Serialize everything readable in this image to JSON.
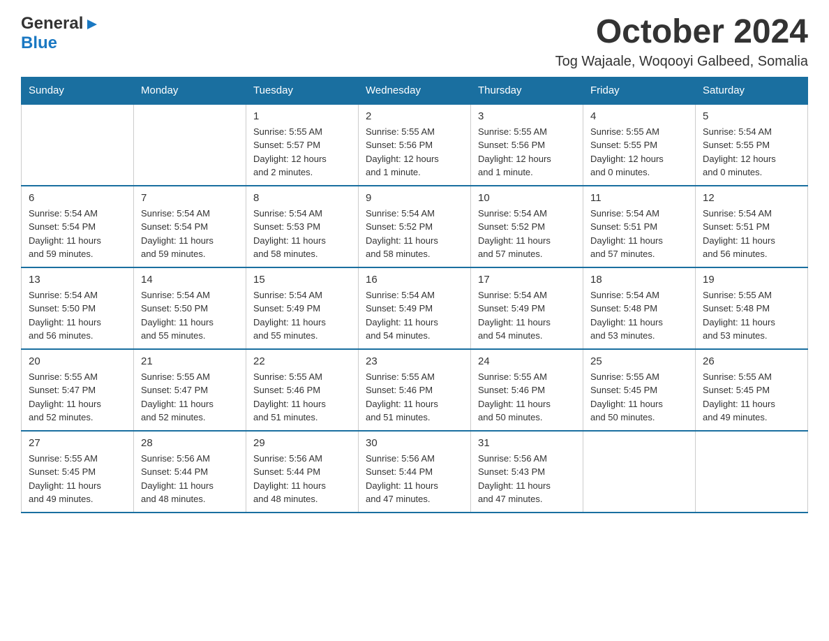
{
  "logo": {
    "general": "General",
    "blue": "Blue"
  },
  "title": "October 2024",
  "location": "Tog Wajaale, Woqooyi Galbeed, Somalia",
  "days": [
    "Sunday",
    "Monday",
    "Tuesday",
    "Wednesday",
    "Thursday",
    "Friday",
    "Saturday"
  ],
  "weeks": [
    [
      {
        "num": "",
        "info": ""
      },
      {
        "num": "",
        "info": ""
      },
      {
        "num": "1",
        "info": "Sunrise: 5:55 AM\nSunset: 5:57 PM\nDaylight: 12 hours\nand 2 minutes."
      },
      {
        "num": "2",
        "info": "Sunrise: 5:55 AM\nSunset: 5:56 PM\nDaylight: 12 hours\nand 1 minute."
      },
      {
        "num": "3",
        "info": "Sunrise: 5:55 AM\nSunset: 5:56 PM\nDaylight: 12 hours\nand 1 minute."
      },
      {
        "num": "4",
        "info": "Sunrise: 5:55 AM\nSunset: 5:55 PM\nDaylight: 12 hours\nand 0 minutes."
      },
      {
        "num": "5",
        "info": "Sunrise: 5:54 AM\nSunset: 5:55 PM\nDaylight: 12 hours\nand 0 minutes."
      }
    ],
    [
      {
        "num": "6",
        "info": "Sunrise: 5:54 AM\nSunset: 5:54 PM\nDaylight: 11 hours\nand 59 minutes."
      },
      {
        "num": "7",
        "info": "Sunrise: 5:54 AM\nSunset: 5:54 PM\nDaylight: 11 hours\nand 59 minutes."
      },
      {
        "num": "8",
        "info": "Sunrise: 5:54 AM\nSunset: 5:53 PM\nDaylight: 11 hours\nand 58 minutes."
      },
      {
        "num": "9",
        "info": "Sunrise: 5:54 AM\nSunset: 5:52 PM\nDaylight: 11 hours\nand 58 minutes."
      },
      {
        "num": "10",
        "info": "Sunrise: 5:54 AM\nSunset: 5:52 PM\nDaylight: 11 hours\nand 57 minutes."
      },
      {
        "num": "11",
        "info": "Sunrise: 5:54 AM\nSunset: 5:51 PM\nDaylight: 11 hours\nand 57 minutes."
      },
      {
        "num": "12",
        "info": "Sunrise: 5:54 AM\nSunset: 5:51 PM\nDaylight: 11 hours\nand 56 minutes."
      }
    ],
    [
      {
        "num": "13",
        "info": "Sunrise: 5:54 AM\nSunset: 5:50 PM\nDaylight: 11 hours\nand 56 minutes."
      },
      {
        "num": "14",
        "info": "Sunrise: 5:54 AM\nSunset: 5:50 PM\nDaylight: 11 hours\nand 55 minutes."
      },
      {
        "num": "15",
        "info": "Sunrise: 5:54 AM\nSunset: 5:49 PM\nDaylight: 11 hours\nand 55 minutes."
      },
      {
        "num": "16",
        "info": "Sunrise: 5:54 AM\nSunset: 5:49 PM\nDaylight: 11 hours\nand 54 minutes."
      },
      {
        "num": "17",
        "info": "Sunrise: 5:54 AM\nSunset: 5:49 PM\nDaylight: 11 hours\nand 54 minutes."
      },
      {
        "num": "18",
        "info": "Sunrise: 5:54 AM\nSunset: 5:48 PM\nDaylight: 11 hours\nand 53 minutes."
      },
      {
        "num": "19",
        "info": "Sunrise: 5:55 AM\nSunset: 5:48 PM\nDaylight: 11 hours\nand 53 minutes."
      }
    ],
    [
      {
        "num": "20",
        "info": "Sunrise: 5:55 AM\nSunset: 5:47 PM\nDaylight: 11 hours\nand 52 minutes."
      },
      {
        "num": "21",
        "info": "Sunrise: 5:55 AM\nSunset: 5:47 PM\nDaylight: 11 hours\nand 52 minutes."
      },
      {
        "num": "22",
        "info": "Sunrise: 5:55 AM\nSunset: 5:46 PM\nDaylight: 11 hours\nand 51 minutes."
      },
      {
        "num": "23",
        "info": "Sunrise: 5:55 AM\nSunset: 5:46 PM\nDaylight: 11 hours\nand 51 minutes."
      },
      {
        "num": "24",
        "info": "Sunrise: 5:55 AM\nSunset: 5:46 PM\nDaylight: 11 hours\nand 50 minutes."
      },
      {
        "num": "25",
        "info": "Sunrise: 5:55 AM\nSunset: 5:45 PM\nDaylight: 11 hours\nand 50 minutes."
      },
      {
        "num": "26",
        "info": "Sunrise: 5:55 AM\nSunset: 5:45 PM\nDaylight: 11 hours\nand 49 minutes."
      }
    ],
    [
      {
        "num": "27",
        "info": "Sunrise: 5:55 AM\nSunset: 5:45 PM\nDaylight: 11 hours\nand 49 minutes."
      },
      {
        "num": "28",
        "info": "Sunrise: 5:56 AM\nSunset: 5:44 PM\nDaylight: 11 hours\nand 48 minutes."
      },
      {
        "num": "29",
        "info": "Sunrise: 5:56 AM\nSunset: 5:44 PM\nDaylight: 11 hours\nand 48 minutes."
      },
      {
        "num": "30",
        "info": "Sunrise: 5:56 AM\nSunset: 5:44 PM\nDaylight: 11 hours\nand 47 minutes."
      },
      {
        "num": "31",
        "info": "Sunrise: 5:56 AM\nSunset: 5:43 PM\nDaylight: 11 hours\nand 47 minutes."
      },
      {
        "num": "",
        "info": ""
      },
      {
        "num": "",
        "info": ""
      }
    ]
  ]
}
